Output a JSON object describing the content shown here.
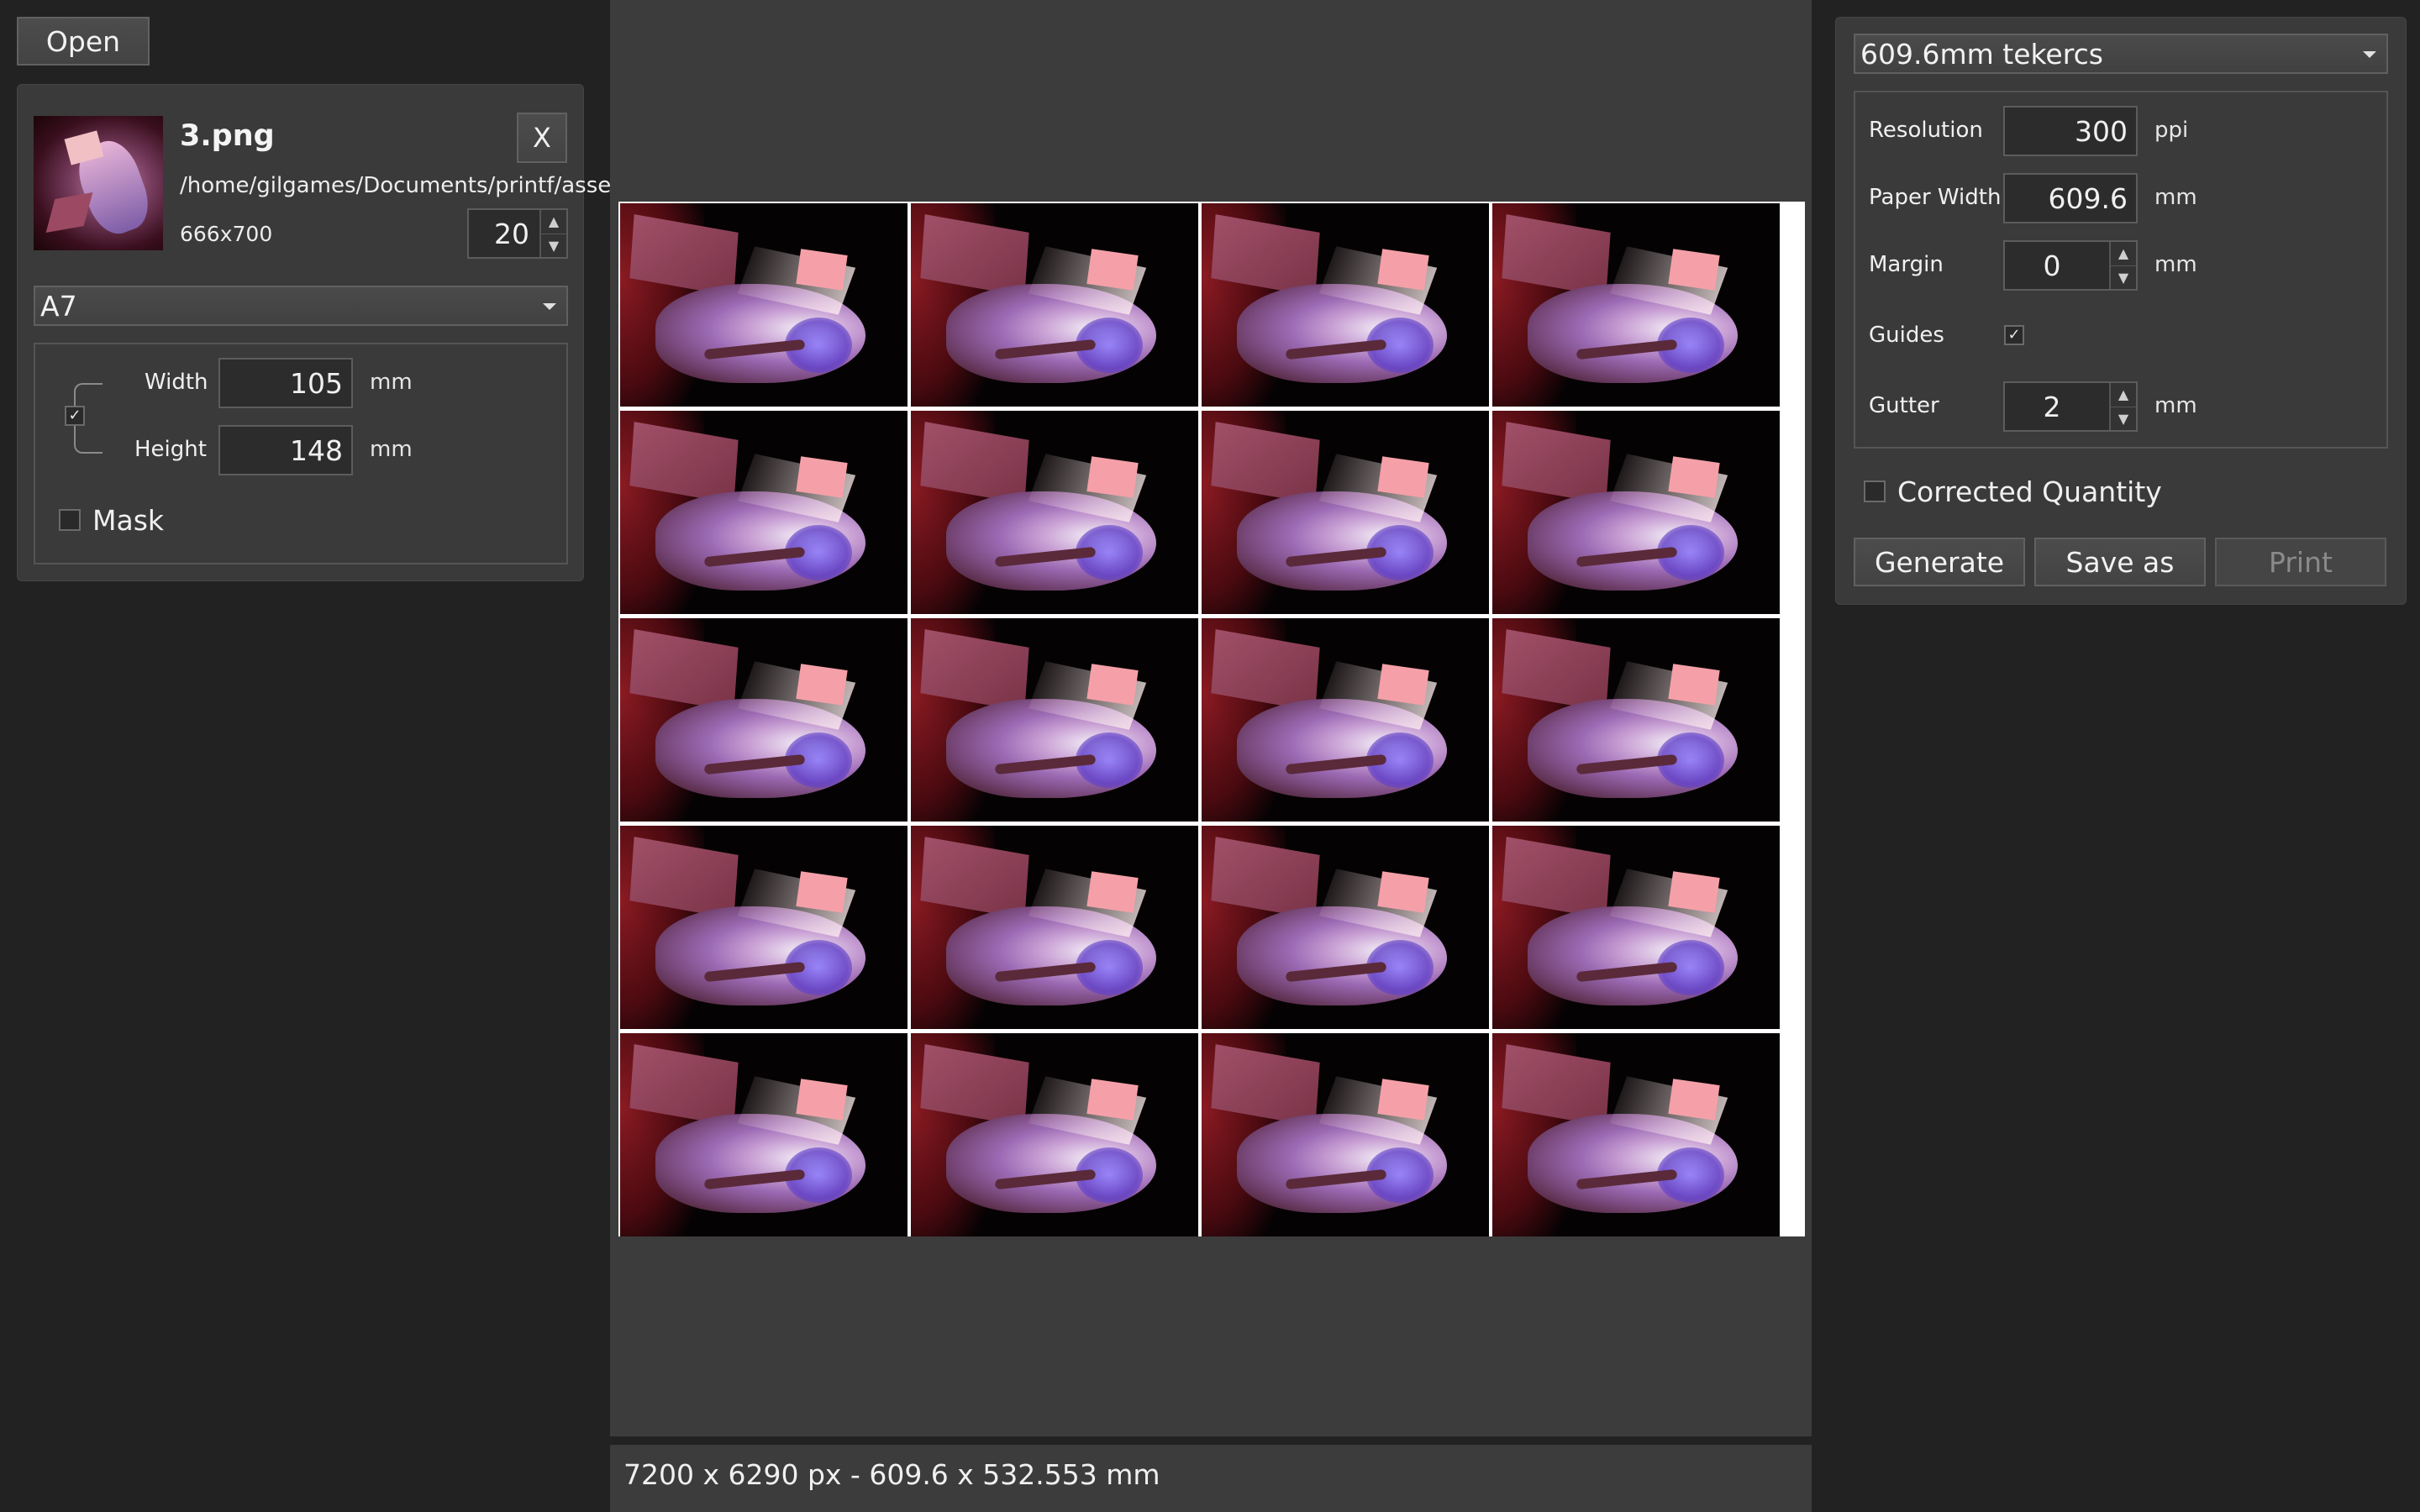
{
  "toolbar": {
    "open_label": "Open"
  },
  "image": {
    "filename": "3.png",
    "path": "/home/gilgames/Documents/printf/asset",
    "dimensions": "666x700",
    "quantity": "20",
    "remove_label": "X"
  },
  "size_preset": {
    "selected": "A7"
  },
  "size": {
    "width_label": "Width",
    "width_value": "105",
    "width_unit": "mm",
    "height_label": "Height",
    "height_value": "148",
    "height_unit": "mm",
    "lock_aspect_checked": true,
    "mask_label": "Mask",
    "mask_checked": false
  },
  "grid": {
    "rows": 5,
    "cols": 4
  },
  "status": {
    "text": "7200 x 6290 px - 609.6 x 532.553 mm"
  },
  "paper": {
    "preset": "609.6mm tekercs",
    "resolution_label": "Resolution",
    "resolution_value": "300",
    "resolution_unit": "ppi",
    "paper_width_label": "Paper Width",
    "paper_width_value": "609.6",
    "paper_width_unit": "mm",
    "margin_label": "Margin",
    "margin_value": "0",
    "margin_unit": "mm",
    "guides_label": "Guides",
    "guides_checked": true,
    "gutter_label": "Gutter",
    "gutter_value": "2",
    "gutter_unit": "mm"
  },
  "corrected_quantity": {
    "label": "Corrected Quantity",
    "checked": false
  },
  "actions": {
    "generate_label": "Generate",
    "save_as_label": "Save as",
    "print_label": "Print"
  }
}
